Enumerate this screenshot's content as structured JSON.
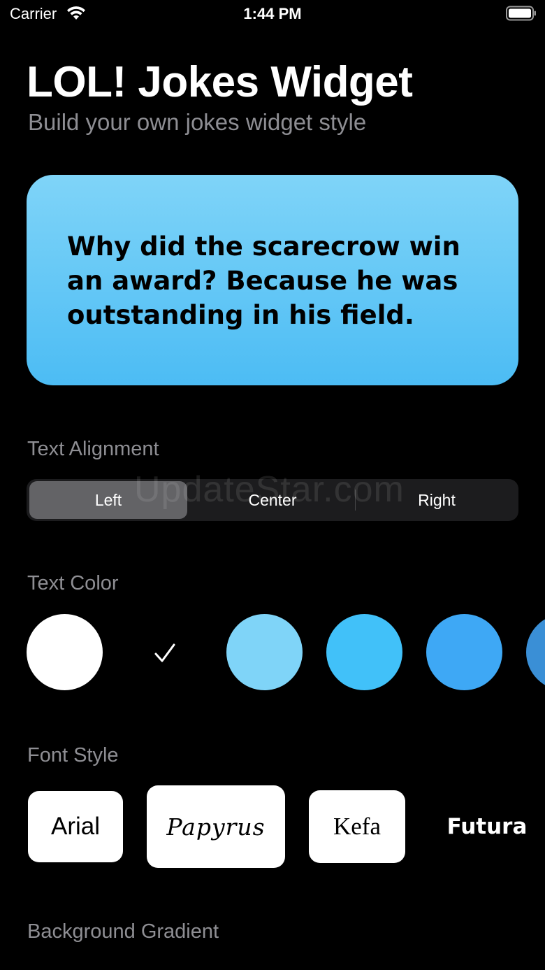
{
  "status_bar": {
    "carrier": "Carrier",
    "time": "1:44 PM"
  },
  "header": {
    "title": "LOL! Jokes Widget",
    "subtitle": "Build your own jokes widget style"
  },
  "preview": {
    "joke": "Why did the scarecrow win an award? Because he was outstanding in his field.",
    "gradient": [
      "#7fd4f8",
      "#4cbcf4"
    ],
    "text_color": "#000000"
  },
  "text_alignment": {
    "label": "Text Alignment",
    "options": [
      "Left",
      "Center",
      "Right"
    ],
    "selected": "Left"
  },
  "watermark": "UpdateStar.com",
  "text_color": {
    "label": "Text Color",
    "swatches": [
      "#ffffff",
      "#000000",
      "#7fd4f8",
      "#41c1f9",
      "#3ea8f5",
      "#3a8fd6"
    ],
    "selected_index": 1
  },
  "font_style": {
    "label": "Font Style",
    "options": [
      "Arial",
      "Papyrus",
      "Kefa",
      "Futura"
    ]
  },
  "background_gradient": {
    "label": "Background Gradient"
  }
}
